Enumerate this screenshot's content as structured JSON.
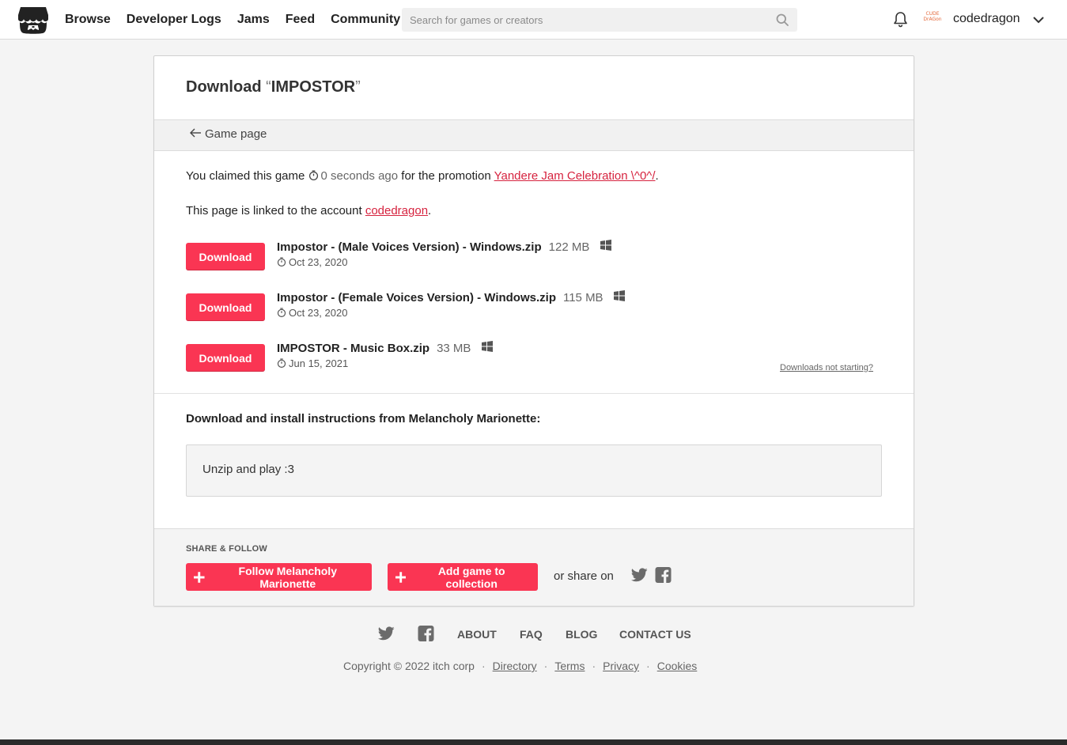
{
  "header": {
    "nav": [
      "Browse",
      "Developer Logs",
      "Jams",
      "Feed",
      "Community"
    ],
    "search_placeholder": "Search for games or creators",
    "avatar_text": "CUDE DrAGon",
    "username": "codedragon"
  },
  "card": {
    "title_prefix": "Download ",
    "open_quote": "“",
    "game_name": "IMPOSTOR",
    "close_quote": "”",
    "back_link": "Game page",
    "claim_text": "You claimed this game",
    "claim_time": "0 seconds ago",
    "claim_mid": "for the promotion",
    "promotion": "Yandere Jam Celebration \\^0^/",
    "claim_end": ".",
    "linked_text": "This page is linked to the account",
    "linked_account": "codedragon",
    "linked_end": ".",
    "downloads": [
      {
        "button": "Download",
        "name": "Impostor - (Male Voices Version) - Windows.zip",
        "size": "122 MB",
        "platform": "windows",
        "date": "Oct 23, 2020"
      },
      {
        "button": "Download",
        "name": "Impostor - (Female Voices Version) - Windows.zip",
        "size": "115 MB",
        "platform": "windows",
        "date": "Oct 23, 2020"
      },
      {
        "button": "Download",
        "name": "IMPOSTOR - Music Box.zip",
        "size": "33 MB",
        "platform": "windows",
        "date": "Jun 15, 2021"
      }
    ],
    "not_starting": "Downloads not starting?",
    "instructions_title": "Download and install instructions from Melancholy Marionette:",
    "instructions_body": "Unzip and play :3",
    "share_label": "SHARE & FOLLOW",
    "follow_button": "Follow Melancholy Marionette",
    "collection_button": "Add game to collection",
    "or_share": "or share on"
  },
  "footer": {
    "links": [
      "ABOUT",
      "FAQ",
      "BLOG",
      "CONTACT US"
    ],
    "copyright": "Copyright © 2022 itch corp",
    "legal": [
      "Directory",
      "Terms",
      "Privacy",
      "Cookies"
    ],
    "separator": "·"
  },
  "colors": {
    "accent": "#fa3553",
    "link": "#d6233f"
  }
}
